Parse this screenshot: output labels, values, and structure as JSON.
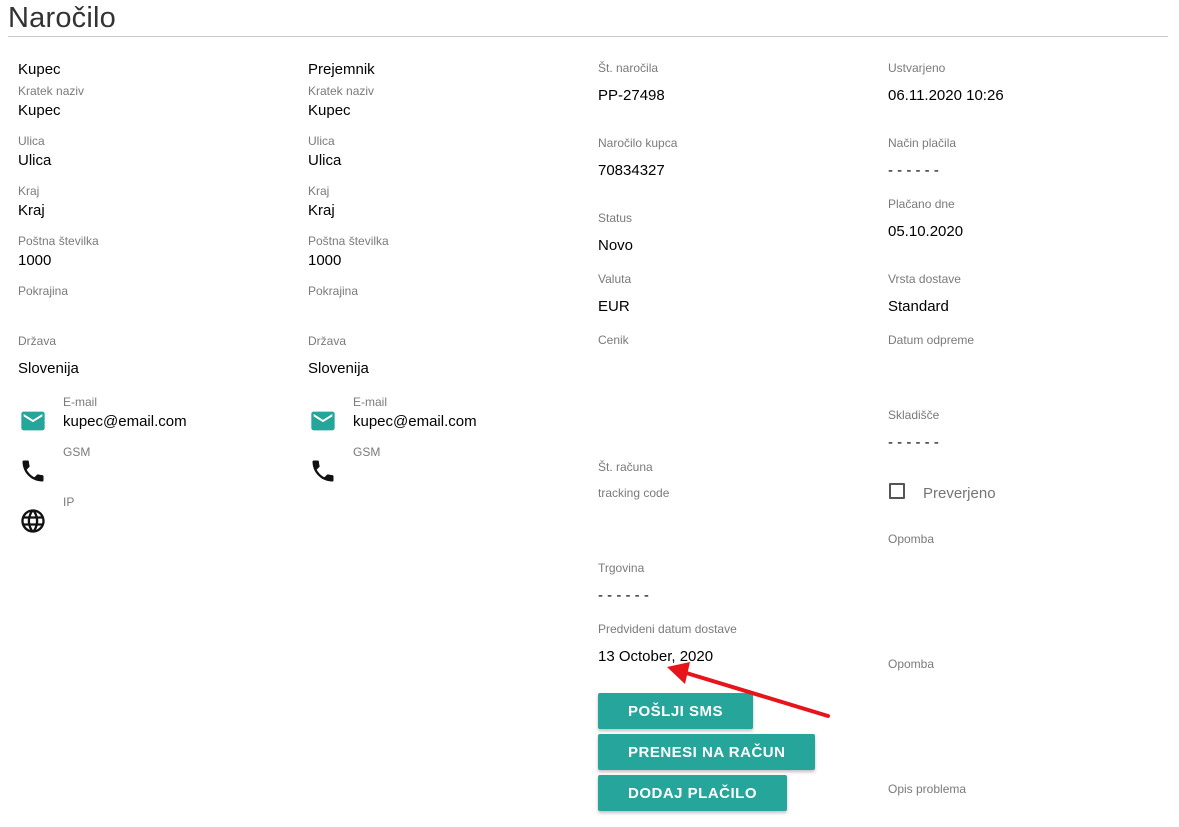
{
  "page_title": "Naročilo",
  "kupec": {
    "header": "Kupec",
    "kratek_naziv_label": "Kratek naziv",
    "kratek_naziv": "Kupec",
    "ulica_label": "Ulica",
    "ulica": "Ulica",
    "kraj_label": "Kraj",
    "kraj": "Kraj",
    "postna_label": "Poštna številka",
    "postna": "1000",
    "pokrajina_label": "Pokrajina",
    "drzava_label": "Država",
    "drzava": "Slovenija",
    "email_label": "E-mail",
    "email": "kupec@email.com",
    "gsm_label": "GSM",
    "ip_label": "IP"
  },
  "prejemnik": {
    "header": "Prejemnik",
    "kratek_naziv_label": "Kratek naziv",
    "kratek_naziv": "Kupec",
    "ulica_label": "Ulica",
    "ulica": "Ulica",
    "kraj_label": "Kraj",
    "kraj": "Kraj",
    "postna_label": "Poštna številka",
    "postna": "1000",
    "pokrajina_label": "Pokrajina",
    "drzava_label": "Država",
    "drzava": "Slovenija",
    "email_label": "E-mail",
    "email": "kupec@email.com",
    "gsm_label": "GSM"
  },
  "order": {
    "st_narocila_label": "Št. naročila",
    "st_narocila": "PP-27498",
    "narocilo_kupca_label": "Naročilo kupca",
    "narocilo_kupca": "70834327",
    "status_label": "Status",
    "status": "Novo",
    "valuta_label": "Valuta",
    "valuta": "EUR",
    "cenik_label": "Cenik",
    "st_racuna_label": "Št. računa",
    "tracking_label": "tracking code",
    "trgovina_label": "Trgovina",
    "trgovina": "- - - - - -",
    "datum_dostave_label": "Predvideni datum dostave",
    "datum_dostave": "13 October, 2020"
  },
  "meta": {
    "ustvarjeno_label": "Ustvarjeno",
    "ustvarjeno": "06.11.2020 10:26",
    "nacin_placila_label": "Način plačila",
    "nacin_placila": "- - - - - -",
    "placano_dne_label": "Plačano dne",
    "placano_dne": "05.10.2020",
    "vrsta_dostave_label": "Vrsta dostave",
    "vrsta_dostave": "Standard",
    "datum_odpreme_label": "Datum odpreme",
    "skladisce_label": "Skladišče",
    "skladisce": "- - - - - -",
    "preverjeno_label": "Preverjeno",
    "opomba1_label": "Opomba",
    "opomba2_label": "Opomba",
    "opis_problema_label": "Opis problema"
  },
  "buttons": {
    "sms": "POŠLJI SMS",
    "racun": "PRENESI NA RAČUN",
    "placilo": "DODAJ PLAČILO"
  },
  "colors": {
    "accent": "#26a69a",
    "annotation_arrow": "#e8141c"
  },
  "icons": [
    "email-icon",
    "phone-icon",
    "globe-icon"
  ]
}
